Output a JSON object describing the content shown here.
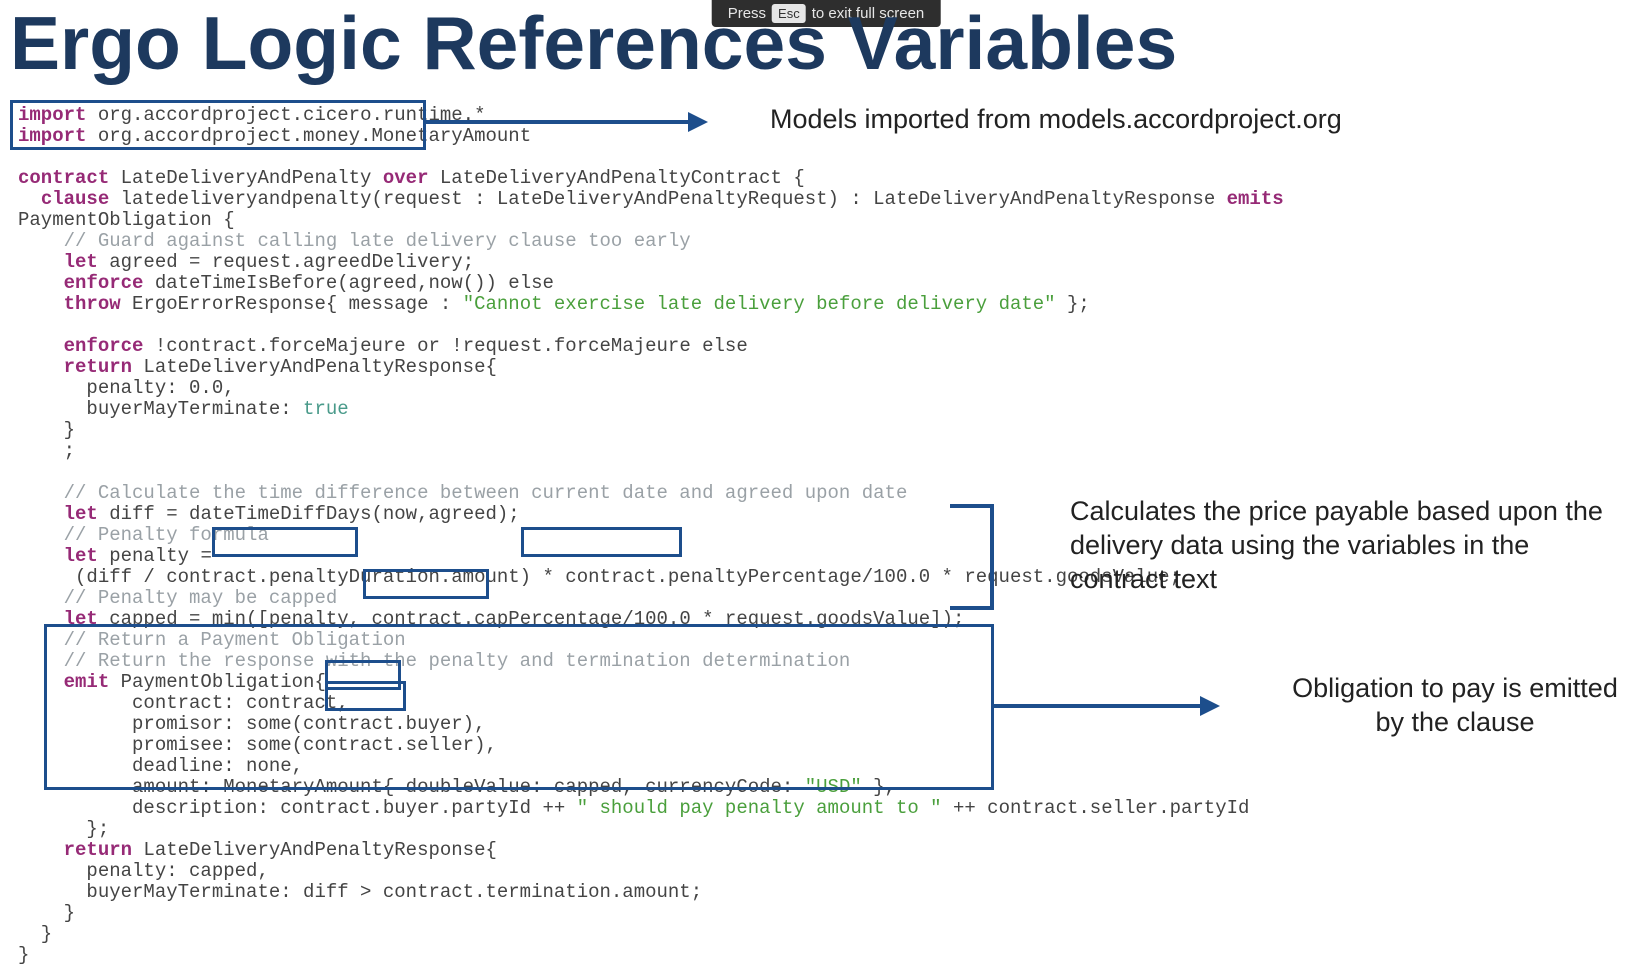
{
  "title": "Ergo Logic References Variables",
  "fullscreen_hint": {
    "pre": "Press",
    "key": "Esc",
    "post": "to exit full screen"
  },
  "annotations": {
    "imports": "Models imported from models.accordproject.org",
    "calc": "Calculates the price payable based upon the delivery data using the variables in the  contract text",
    "obligation": "Obligation to pay is emitted by the clause"
  },
  "code": {
    "import_kw": "import",
    "import1_rest": " org.accordproject.cicero.runtime.*",
    "import2_rest": " org.accordproject.money.MonetaryAmount",
    "l3a": "contract",
    "l3b": " LateDeliveryAndPenalty ",
    "l3c": "over",
    "l3d": " LateDeliveryAndPenaltyContract {",
    "l4a": "  ",
    "l4b": "clause",
    "l4c": " latedeliveryandpenalty(request : LateDeliveryAndPenaltyRequest) : LateDeliveryAndPenaltyResponse ",
    "l4d": "emits",
    "l5": "PaymentObligation {",
    "l6": "    // Guard against calling late delivery clause too early",
    "l7a": "    ",
    "l7b": "let",
    "l7c": " agreed = request.agreedDelivery;",
    "l8a": "    ",
    "l8b": "enforce",
    "l8c": " dateTimeIsBefore(agreed,now()) else",
    "l9a": "    ",
    "l9b": "throw",
    "l9c": " ErgoErrorResponse{ message : ",
    "l9d": "\"Cannot exercise late delivery before delivery date\"",
    "l9e": " };",
    "l10": "",
    "l11a": "    ",
    "l11b": "enforce",
    "l11c": " !contract.forceMajeure or !request.forceMajeure else",
    "l12a": "    ",
    "l12b": "return",
    "l12c": " LateDeliveryAndPenaltyResponse{",
    "l13": "      penalty: 0.0,",
    "l14a": "      buyerMayTerminate: ",
    "l14b": "true",
    "l15": "    }",
    "l16": "    ;",
    "l17": "",
    "l18": "    // Calculate the time difference between current date and agreed upon date",
    "l19a": "    ",
    "l19b": "let",
    "l19c": " diff = dateTimeDiffDays(now,agreed);",
    "l20": "    // Penalty formula",
    "l21a": "    ",
    "l21b": "let",
    "l21c": " penalty =",
    "l22": "     (diff / contract.penaltyDuration.amount) * contract.penaltyPercentage/100.0 * request.goodsValue;",
    "l23": "    // Penalty may be capped",
    "l24a": "    ",
    "l24b": "let",
    "l24c": " capped = min([penalty, contract.capPercentage/100.0 * request.goodsValue]);",
    "l25": "    // Return a Payment Obligation",
    "l26": "    // Return the response with the penalty and termination determination",
    "l27a": "    ",
    "l27b": "emit",
    "l27c": " PaymentObligation{",
    "l28": "          contract: contract,",
    "l29": "          promisor: some(contract.buyer),",
    "l30": "          promisee: some(contract.seller),",
    "l31": "          deadline: none,",
    "l32a": "          amount: MonetaryAmount{ doubleValue: capped, currencyCode: ",
    "l32b": "\"USD\"",
    "l32c": " },",
    "l33a": "          description: contract.buyer.partyId ++ ",
    "l33b": "\" should pay penalty amount to \"",
    "l33c": " ++ contract.seller.partyId",
    "l34": "      };",
    "l35a": "    ",
    "l35b": "return",
    "l35c": " LateDeliveryAndPenaltyResponse{",
    "l36": "      penalty: capped,",
    "l37": "      buyerMayTerminate: diff > contract.termination.amount;",
    "l38": "    }",
    "l39": "  }",
    "l40": "}"
  }
}
